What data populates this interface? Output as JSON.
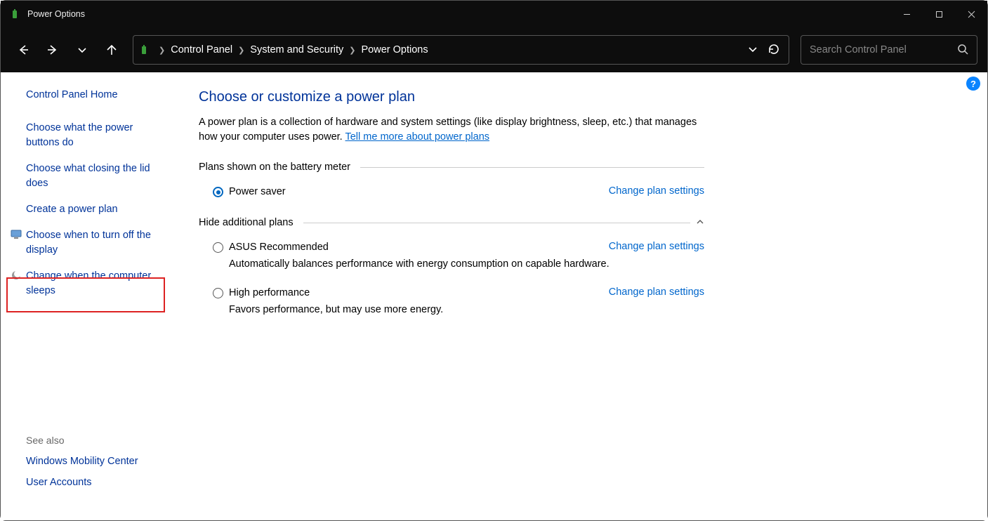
{
  "window": {
    "title": "Power Options"
  },
  "breadcrumbs": {
    "b0": "Control Panel",
    "b1": "System and Security",
    "b2": "Power Options"
  },
  "search": {
    "placeholder": "Search Control Panel"
  },
  "sidebar": {
    "home": "Control Panel Home",
    "l0": "Choose what the power buttons do",
    "l1": "Choose what closing the lid does",
    "l2": "Create a power plan",
    "l3": "Choose when to turn off the display",
    "l4": "Change when the computer sleeps"
  },
  "seealso": {
    "title": "See also",
    "l0": "Windows Mobility Center",
    "l1": "User Accounts"
  },
  "main": {
    "title": "Choose or customize a power plan",
    "descA": "A power plan is a collection of hardware and system settings (like display brightness, sleep, etc.) that manages how your computer uses power. ",
    "descLink": "Tell me more about power plans",
    "section1": "Plans shown on the battery meter",
    "section2": "Hide additional plans",
    "changeLink": "Change plan settings",
    "plans": {
      "p0": {
        "name": "Power saver"
      },
      "p1": {
        "name": "ASUS Recommended",
        "desc": "Automatically balances performance with energy consumption on capable hardware."
      },
      "p2": {
        "name": "High performance",
        "desc": "Favors performance, but may use more energy."
      }
    }
  },
  "help": "?"
}
